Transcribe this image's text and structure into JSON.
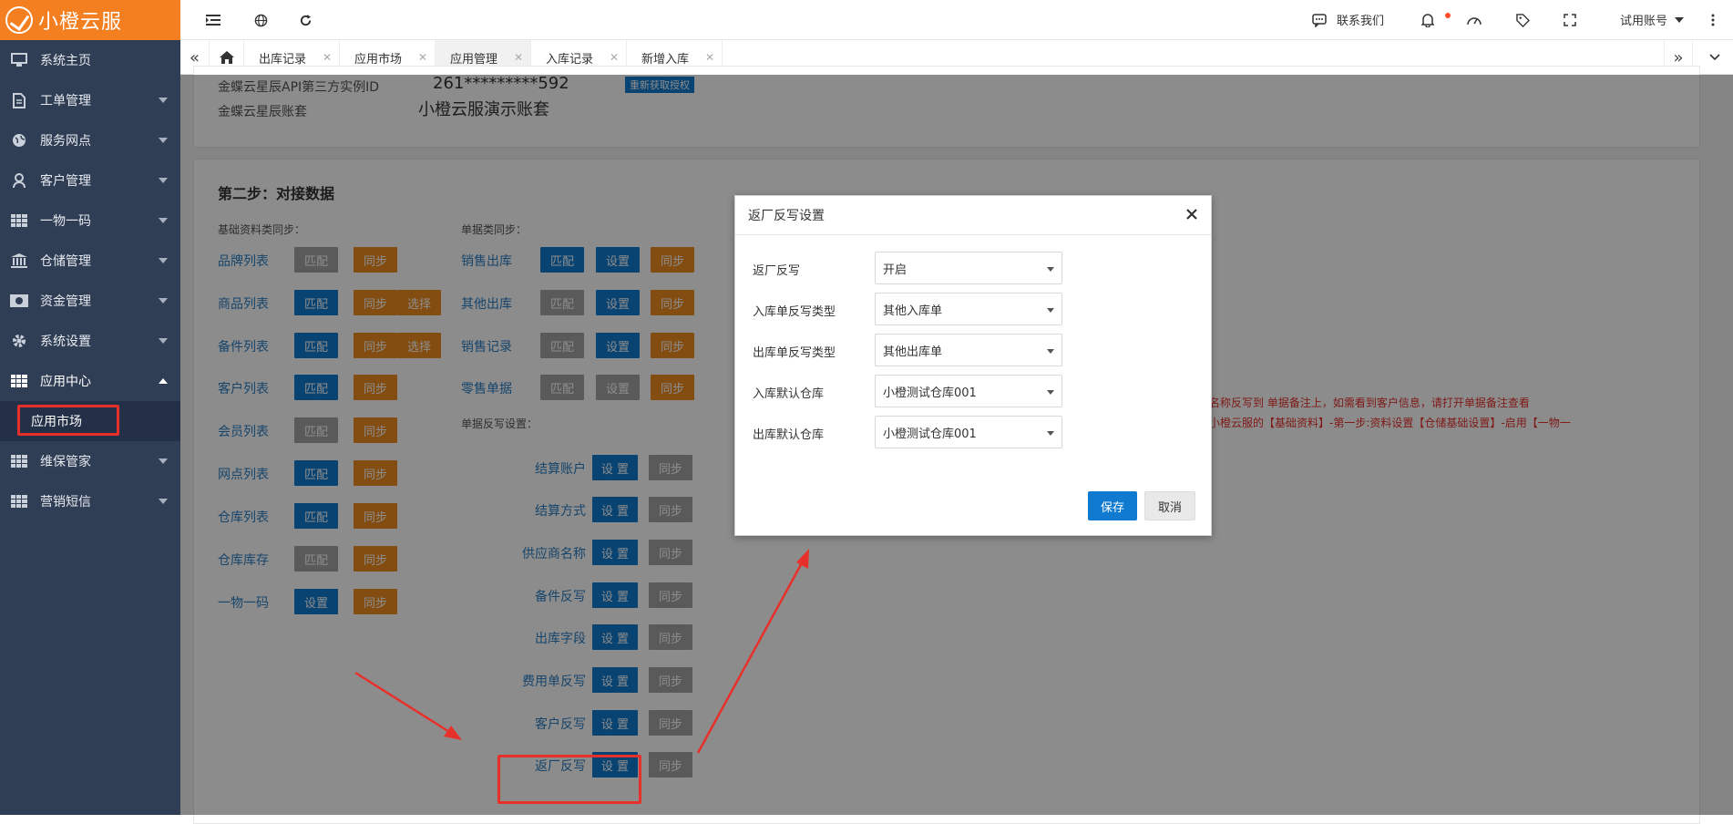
{
  "app": {
    "logo_text": "小橙云服"
  },
  "sidebar": {
    "items": [
      {
        "label": "系统主页",
        "icon": "monitor-icon"
      },
      {
        "label": "工单管理",
        "icon": "document-icon"
      },
      {
        "label": "服务网点",
        "icon": "globe-icon"
      },
      {
        "label": "客户管理",
        "icon": "user-icon"
      },
      {
        "label": "一物一码",
        "icon": "grid-icon"
      },
      {
        "label": "仓储管理",
        "icon": "bank-icon"
      },
      {
        "label": "资金管理",
        "icon": "money-icon"
      },
      {
        "label": "系统设置",
        "icon": "gear-icon"
      },
      {
        "label": "应用中心",
        "icon": "grid-icon"
      },
      {
        "label": "维保管家",
        "icon": "grid-icon"
      },
      {
        "label": "营销短信",
        "icon": "grid-icon"
      }
    ],
    "sub_item": "应用市场"
  },
  "topbar": {
    "contact": "联系我们",
    "account": "试用账号"
  },
  "tabs": [
    "出库记录",
    "应用市场",
    "应用管理",
    "入库记录",
    "新增入库"
  ],
  "top_section": {
    "api_label": "金蝶云星辰API第三方实例ID",
    "api_value": "261*********592",
    "reauth": "重新获取授权",
    "account_label": "金蝶云星辰账套",
    "account_value": "小橙云服演示账套"
  },
  "step2": {
    "title": "第二步：对接数据",
    "basic_title": "基础资料类同步：",
    "bill_title": "单据类同步：",
    "writeback_title": "单据反写设置：",
    "basic_rows": [
      {
        "name": "品牌列表",
        "b1": "匹配",
        "b2": "同步"
      },
      {
        "name": "商品列表",
        "b1": "匹配",
        "b2": "同步",
        "b3": "选择"
      },
      {
        "name": "备件列表",
        "b1": "匹配",
        "b2": "同步",
        "b3": "选择"
      },
      {
        "name": "客户列表",
        "b1": "匹配",
        "b2": "同步"
      },
      {
        "name": "会员列表",
        "b1": "匹配",
        "b2": "同步"
      },
      {
        "name": "网点列表",
        "b1": "匹配",
        "b2": "同步"
      },
      {
        "name": "仓库列表",
        "b1": "匹配",
        "b2": "同步"
      },
      {
        "name": "仓库库存",
        "b1": "匹配",
        "b2": "同步"
      },
      {
        "name": "一物一码",
        "b1": "设置",
        "b2": "同步"
      }
    ],
    "bill_rows": [
      {
        "name": "销售出库",
        "b1": "匹配",
        "b2": "设置",
        "b3": "同步"
      },
      {
        "name": "其他出库",
        "b1": "匹配",
        "b2": "设置",
        "b3": "同步"
      },
      {
        "name": "销售记录",
        "b1": "匹配",
        "b2": "设置",
        "b3": "同步"
      },
      {
        "name": "零售单据",
        "b1": "匹配",
        "b2": "设置",
        "b3": "同步"
      }
    ],
    "writeback_rows": [
      {
        "name": "结算账户",
        "b1": "设 置",
        "b2": "同步"
      },
      {
        "name": "结算方式",
        "b1": "设 置",
        "b2": "同步"
      },
      {
        "name": "供应商名称",
        "b1": "设 置",
        "b2": "同步"
      },
      {
        "name": "备件反写",
        "b1": "设 置",
        "b2": "同步"
      },
      {
        "name": "出库字段",
        "b1": "设 置",
        "b2": "同步"
      },
      {
        "name": "费用单反写",
        "b1": "设 置",
        "b2": "同步"
      },
      {
        "name": "客户反写",
        "b1": "设 置",
        "b2": "同步"
      },
      {
        "name": "返厂反写",
        "b1": "设 置",
        "b2": "同步"
      }
    ],
    "note_line1": "名称反写到 单据备注上，如需看到客户信息，请打开单据备注查看",
    "note_line2": "小橙云服的【基础资料】-第一步:资料设置【仓储基础设置】-启用【一物一"
  },
  "modal": {
    "title": "返厂反写设置",
    "fields": [
      {
        "label": "返厂反写",
        "value": "开启"
      },
      {
        "label": "入库单反写类型",
        "value": "其他入库单"
      },
      {
        "label": "出库单反写类型",
        "value": "其他出库单"
      },
      {
        "label": "入库默认仓库",
        "value": "小橙测试仓库001"
      },
      {
        "label": "出库默认仓库",
        "value": "小橙测试仓库001"
      }
    ],
    "save": "保存",
    "cancel": "取消"
  },
  "colors": {
    "brand": "#f47f20",
    "sidebar": "#2f3e55",
    "primary": "#0f7ad0",
    "orange": "#ee8d22",
    "highlight": "#e8302b"
  }
}
